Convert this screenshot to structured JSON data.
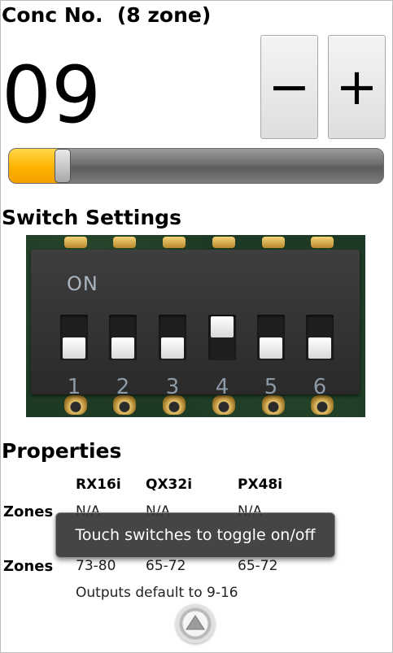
{
  "header": {
    "title": "Conc No.  (8 zone)",
    "value": "09"
  },
  "stepper": {
    "minus_label": "−",
    "plus_label": "+"
  },
  "slider": {
    "value_fraction": 0.14
  },
  "switch_settings": {
    "heading": "Switch Settings",
    "on_label": "ON",
    "switches": [
      {
        "number": "1",
        "state": "off"
      },
      {
        "number": "2",
        "state": "off"
      },
      {
        "number": "3",
        "state": "off"
      },
      {
        "number": "4",
        "state": "on"
      },
      {
        "number": "5",
        "state": "off"
      },
      {
        "number": "6",
        "state": "off"
      }
    ]
  },
  "properties": {
    "heading": "Properties",
    "columns": [
      "RX16i",
      "QX32i",
      "PX48i"
    ],
    "rows": [
      {
        "label": "Zones",
        "values": [
          "N/A",
          "N/A",
          "N/A"
        ]
      },
      {
        "label": "Zones",
        "values": [
          "73-80",
          "65-72",
          "65-72"
        ]
      }
    ],
    "note": "Outputs default to 9-16"
  },
  "toast": {
    "text": "Touch switches to toggle on/off"
  },
  "colors": {
    "slider_fill": "#ffb300",
    "board": "#1e3a24"
  }
}
